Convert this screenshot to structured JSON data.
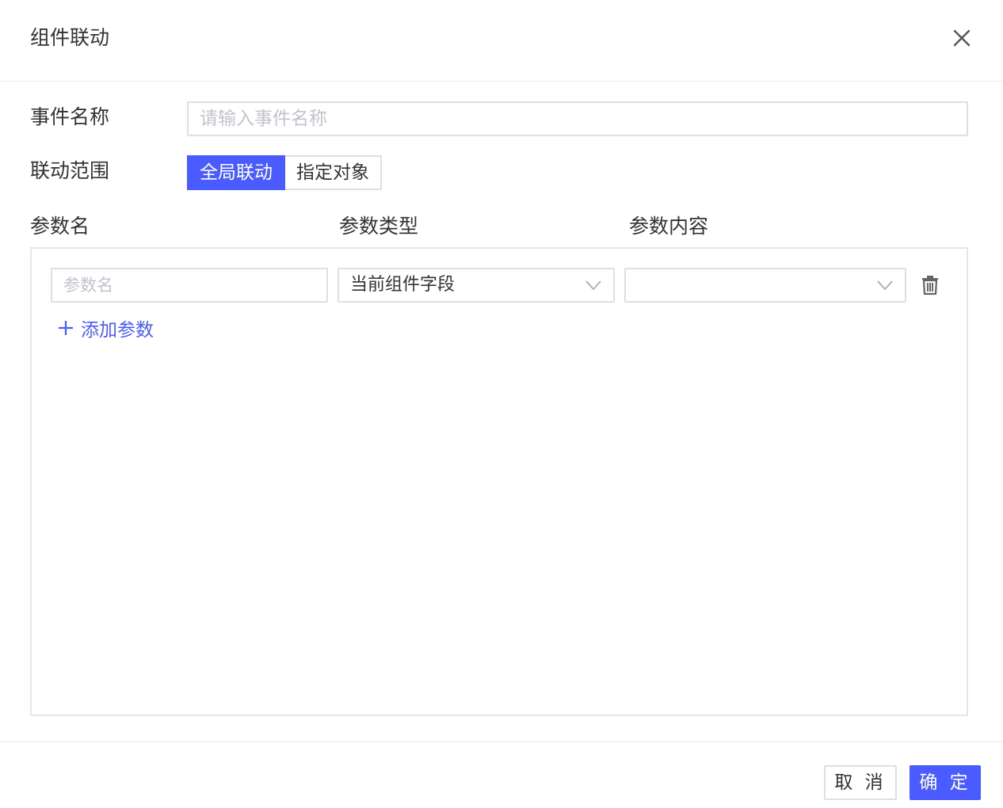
{
  "dialog": {
    "title": "组件联动"
  },
  "form": {
    "event_name_label": "事件名称",
    "event_name_placeholder": "请输入事件名称",
    "event_name_value": "",
    "scope_label": "联动范围",
    "scope_options": [
      "全局联动",
      "指定对象"
    ],
    "scope_selected": "全局联动"
  },
  "params": {
    "columns": [
      "参数名",
      "参数类型",
      "参数内容"
    ],
    "rows": [
      {
        "name_placeholder": "参数名",
        "name_value": "",
        "type_value": "当前组件字段",
        "content_value": ""
      }
    ],
    "add_label": "添加参数"
  },
  "footer": {
    "cancel_label": "取 消",
    "ok_label": "确 定"
  },
  "colors": {
    "primary": "#4a5cff",
    "border": "#dcdfe6",
    "placeholder": "#c0c4cc"
  },
  "icons": {
    "close": "close-icon",
    "chevron": "chevron-down-icon",
    "delete": "trash-icon",
    "add": "plus-icon"
  }
}
